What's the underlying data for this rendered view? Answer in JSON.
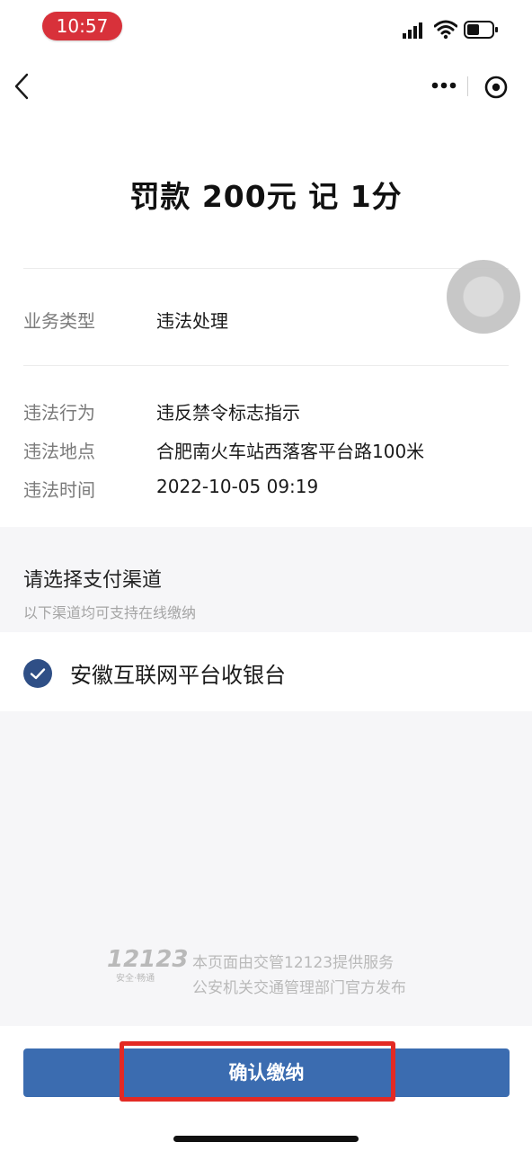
{
  "status_bar": {
    "time": "10:57"
  },
  "fine_summary": "罚款 200元 记 1分",
  "business": {
    "label": "业务类型",
    "value": "违法处理"
  },
  "details": [
    {
      "label": "违法行为",
      "value": "违反禁令标志指示"
    },
    {
      "label": "违法地点",
      "value": "合肥南火车站西落客平台路100米"
    },
    {
      "label": "违法时间",
      "value": "2022-10-05 09:19"
    }
  ],
  "payment": {
    "title": "请选择支付渠道",
    "subtitle": "以下渠道均可支持在线缴纳",
    "channel_label": "安徽互联网平台收银台"
  },
  "footer": {
    "logo_number": "12123",
    "logo_slogan": "安全·畅通",
    "line1": "本页面由交管12123提供服务",
    "line2": "公安机关交通管理部门官方发布"
  },
  "confirm_label": "确认缴纳",
  "colors": {
    "accent": "#3b6cb0",
    "check": "#2f4f86",
    "highlight": "#e32a24",
    "time_pill": "#d8313a"
  }
}
